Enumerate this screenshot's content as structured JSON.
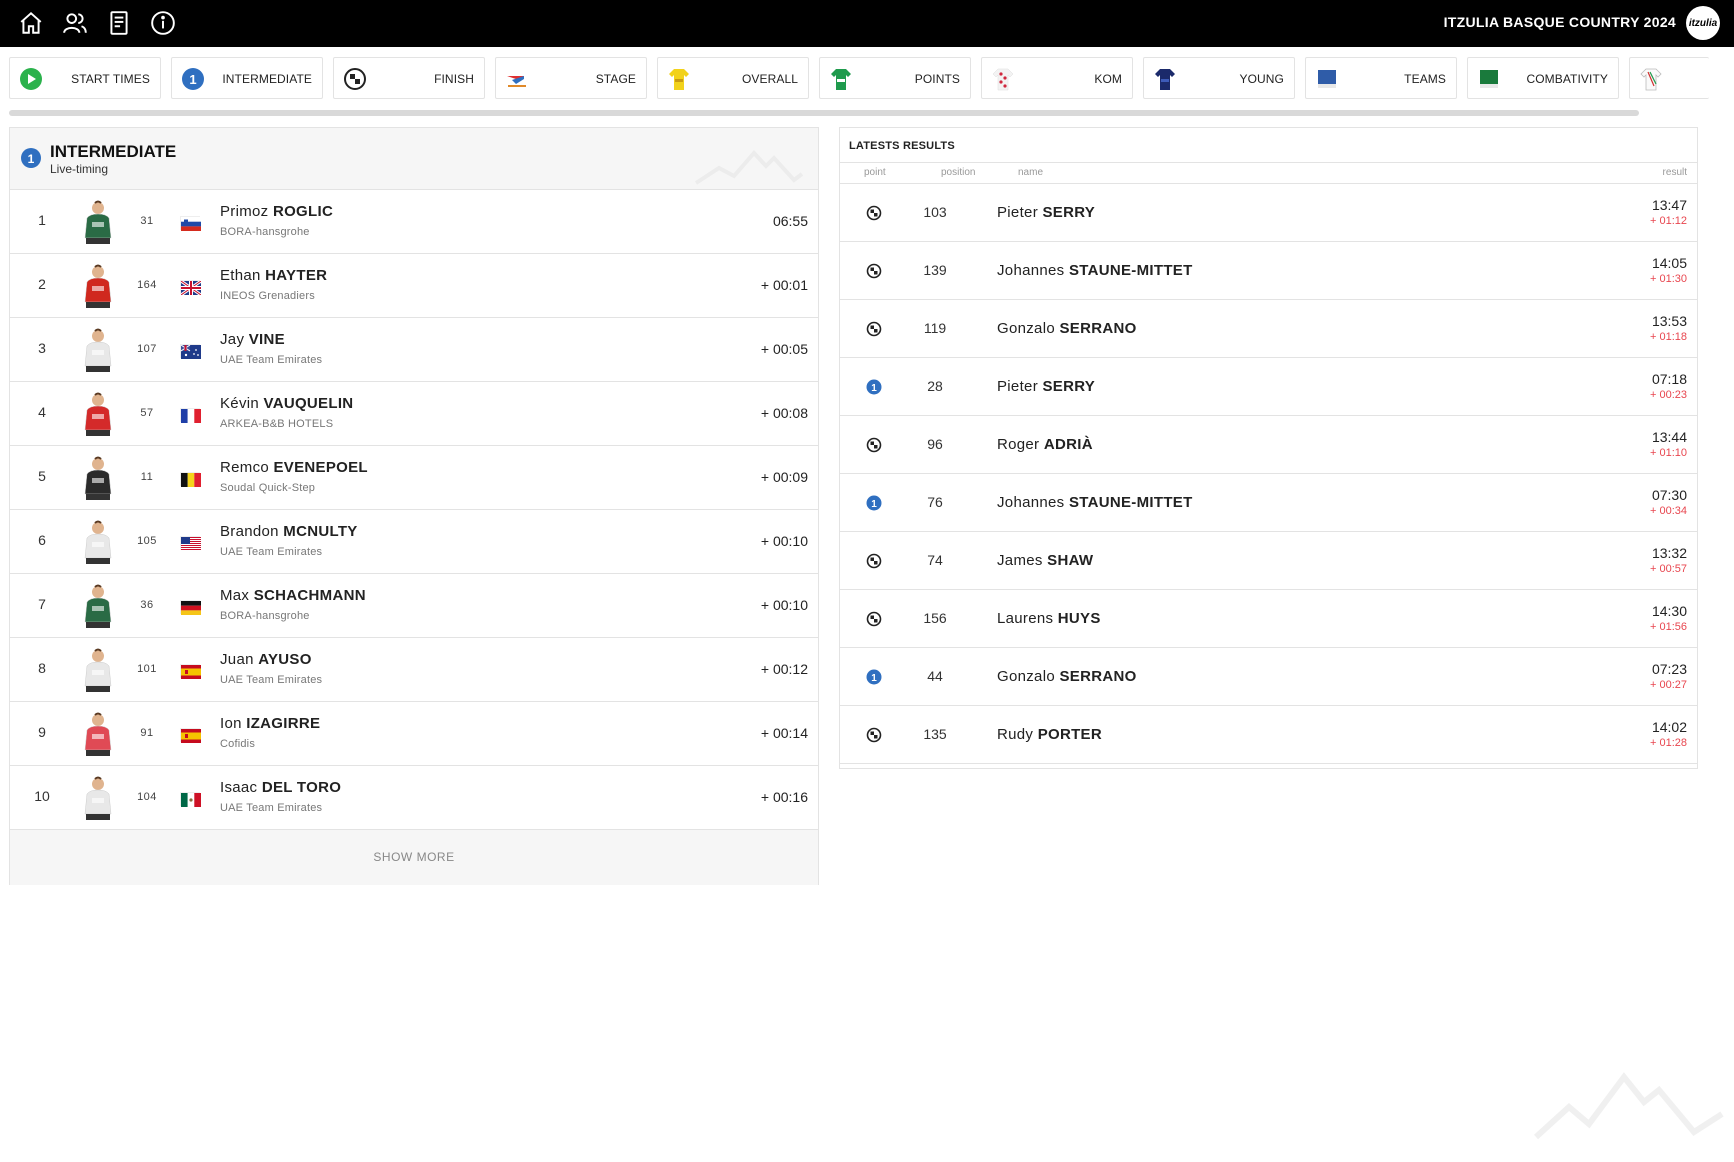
{
  "header": {
    "event_title": "ITZULIA BASQUE COUNTRY 2024",
    "logo_text": "itzulia",
    "nav_icons": [
      "home-icon",
      "users-icon",
      "document-icon",
      "info-icon"
    ]
  },
  "tabs": [
    {
      "label": "START TIMES",
      "icon": "play-icon"
    },
    {
      "label": "INTERMEDIATE",
      "icon": "intermediate-1-icon"
    },
    {
      "label": "FINISH",
      "icon": "checkered-flag-icon"
    },
    {
      "label": "STAGE",
      "icon": "stage-sponsor-icon"
    },
    {
      "label": "OVERALL",
      "icon": "yellow-jersey-icon"
    },
    {
      "label": "POINTS",
      "icon": "green-jersey-icon"
    },
    {
      "label": "KOM",
      "icon": "polka-dot-jersey-icon"
    },
    {
      "label": "YOUNG",
      "icon": "blue-jersey-icon"
    },
    {
      "label": "TEAMS",
      "icon": "teams-jersey-icon"
    },
    {
      "label": "COMBATIVITY",
      "icon": "combativity-jersey-icon"
    },
    {
      "label": "",
      "icon": "white-jersey-icon"
    }
  ],
  "intermediate": {
    "title": "INTERMEDIATE",
    "subtitle": "Live-timing",
    "show_more": "SHOW MORE",
    "rows": [
      {
        "pos": "1",
        "bib": "31",
        "first": "Primoz",
        "last": "ROGLIC",
        "team": "BORA-hansgrohe",
        "time": "06:55",
        "flag": "slovenia",
        "kit": "#2a6b45"
      },
      {
        "pos": "2",
        "bib": "164",
        "first": "Ethan",
        "last": "HAYTER",
        "team": "INEOS Grenadiers",
        "time": "+ 00:01",
        "flag": "uk",
        "kit": "#d0281e"
      },
      {
        "pos": "3",
        "bib": "107",
        "first": "Jay",
        "last": "VINE",
        "team": "UAE Team Emirates",
        "time": "+ 00:05",
        "flag": "australia",
        "kit": "#e8e8e8"
      },
      {
        "pos": "4",
        "bib": "57",
        "first": "Kévin",
        "last": "VAUQUELIN",
        "team": "ARKEA-B&B HOTELS",
        "time": "+ 00:08",
        "flag": "france",
        "kit": "#d42a2a"
      },
      {
        "pos": "5",
        "bib": "11",
        "first": "Remco",
        "last": "EVENEPOEL",
        "team": "Soudal Quick-Step",
        "time": "+ 00:09",
        "flag": "belgium",
        "kit": "#2b2b2b"
      },
      {
        "pos": "6",
        "bib": "105",
        "first": "Brandon",
        "last": "MCNULTY",
        "team": "UAE Team Emirates",
        "time": "+ 00:10",
        "flag": "usa",
        "kit": "#e8e8e8"
      },
      {
        "pos": "7",
        "bib": "36",
        "first": "Max",
        "last": "SCHACHMANN",
        "team": "BORA-hansgrohe",
        "time": "+ 00:10",
        "flag": "germany",
        "kit": "#2a6b45"
      },
      {
        "pos": "8",
        "bib": "101",
        "first": "Juan",
        "last": "AYUSO",
        "team": "UAE Team Emirates",
        "time": "+ 00:12",
        "flag": "spain",
        "kit": "#e8e8e8"
      },
      {
        "pos": "9",
        "bib": "91",
        "first": "Ion",
        "last": "IZAGIRRE",
        "team": "Cofidis",
        "time": "+ 00:14",
        "flag": "spain",
        "kit": "#e04a55"
      },
      {
        "pos": "10",
        "bib": "104",
        "first": "Isaac",
        "last": "DEL TORO",
        "team": "UAE Team Emirates",
        "time": "+ 00:16",
        "flag": "mexico",
        "kit": "#e8e8e8"
      }
    ]
  },
  "latest": {
    "title": "LATESTS RESULTS",
    "columns": {
      "point": "point",
      "position": "position",
      "name": "name",
      "result": "result"
    },
    "rows": [
      {
        "point": "finish",
        "pos": "103",
        "first": "Pieter",
        "last": "SERRY",
        "time": "13:47",
        "gap": "+ 01:12"
      },
      {
        "point": "finish",
        "pos": "139",
        "first": "Johannes",
        "last": "STAUNE-MITTET",
        "time": "14:05",
        "gap": "+ 01:30"
      },
      {
        "point": "finish",
        "pos": "119",
        "first": "Gonzalo",
        "last": "SERRANO",
        "time": "13:53",
        "gap": "+ 01:18"
      },
      {
        "point": "intermediate",
        "pos": "28",
        "first": "Pieter",
        "last": "SERRY",
        "time": "07:18",
        "gap": "+ 00:23"
      },
      {
        "point": "finish",
        "pos": "96",
        "first": "Roger",
        "last": "ADRIÀ",
        "time": "13:44",
        "gap": "+ 01:10"
      },
      {
        "point": "intermediate",
        "pos": "76",
        "first": "Johannes",
        "last": "STAUNE-MITTET",
        "time": "07:30",
        "gap": "+ 00:34"
      },
      {
        "point": "finish",
        "pos": "74",
        "first": "James",
        "last": "SHAW",
        "time": "13:32",
        "gap": "+ 00:57"
      },
      {
        "point": "finish",
        "pos": "156",
        "first": "Laurens",
        "last": "HUYS",
        "time": "14:30",
        "gap": "+ 01:56"
      },
      {
        "point": "intermediate",
        "pos": "44",
        "first": "Gonzalo",
        "last": "SERRANO",
        "time": "07:23",
        "gap": "+ 00:27"
      },
      {
        "point": "finish",
        "pos": "135",
        "first": "Rudy",
        "last": "PORTER",
        "time": "14:02",
        "gap": "+ 01:28"
      }
    ]
  },
  "colors": {
    "accent_blue": "#2f6fc0",
    "gap_red": "#e8464f",
    "play_green": "#2bb24c"
  }
}
